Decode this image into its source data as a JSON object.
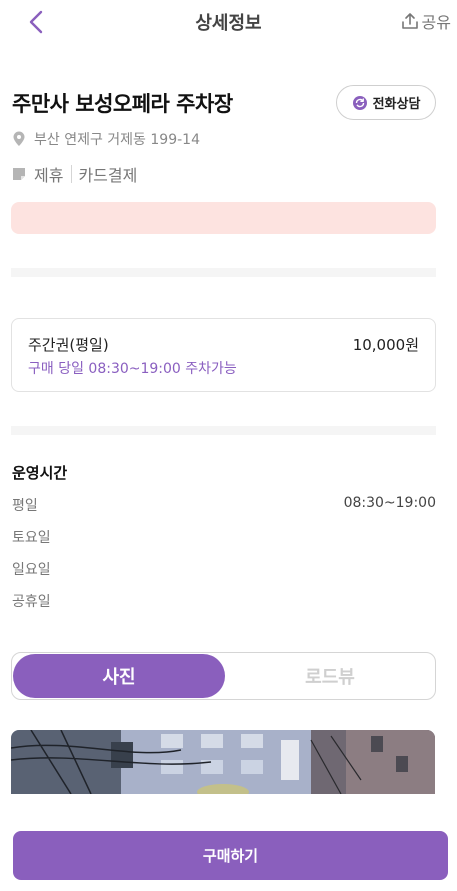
{
  "header": {
    "title": "상세정보",
    "share_label": "공유",
    "back_icon": "chevron-left-icon",
    "share_icon": "share-upload-icon"
  },
  "place": {
    "name": "주만사 보성오페라 주차장",
    "call_label": "전화상담",
    "call_icon": "phone-refresh-icon",
    "address": "부산 연제구 거제동 199-14",
    "address_icon": "location-pin-icon",
    "tag_icon": "note-icon",
    "tags": [
      "제휴",
      "카드결제"
    ]
  },
  "ticket": {
    "name": "주간권(평일)",
    "price": "10,000원",
    "description": "구매 당일 08:30~19:00 주차가능"
  },
  "hours": {
    "title": "운영시간",
    "rows": [
      {
        "day": "평일",
        "time": "08:30~19:00"
      },
      {
        "day": "토요일",
        "time": ""
      },
      {
        "day": "일요일",
        "time": ""
      },
      {
        "day": "공휴일",
        "time": ""
      }
    ]
  },
  "media_toggle": {
    "options": [
      "사진",
      "로드뷰"
    ],
    "selected": "사진"
  },
  "buy_button": {
    "label": "구매하기"
  },
  "colors": {
    "accent": "#8a5fbd",
    "alert_bg": "#fde3e0",
    "divider": "#f5f5f5"
  }
}
